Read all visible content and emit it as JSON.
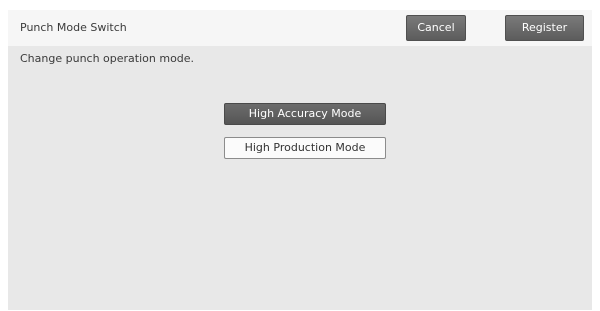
{
  "header": {
    "title": "Punch Mode Switch",
    "cancel_label": "Cancel",
    "register_label": "Register"
  },
  "main": {
    "description": "Change punch operation mode.",
    "modes": [
      {
        "label": "High Accuracy Mode",
        "selected": true
      },
      {
        "label": "High Production Mode",
        "selected": false
      }
    ]
  },
  "colors": {
    "selected_button": "#5f5f5f",
    "header_button": "#6a6a6a",
    "panel_background": "#e8e8e8"
  }
}
